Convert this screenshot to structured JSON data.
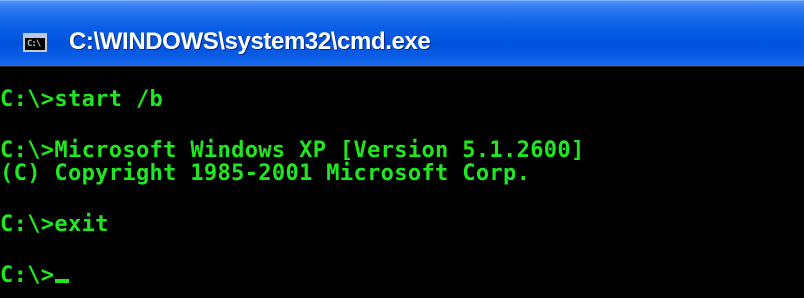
{
  "window": {
    "title": "C:\\WINDOWS\\system32\\cmd.exe",
    "icon_text": "C:\\"
  },
  "console": {
    "lines": [
      "C:\\>start /b",
      "C:\\>Microsoft Windows XP [Version 5.1.2600]",
      "(C) Copyright 1985-2001 Microsoft Corp.",
      "C:\\>exit",
      "C:\\>"
    ],
    "text_color": "#20e820",
    "background_color": "#000000"
  }
}
